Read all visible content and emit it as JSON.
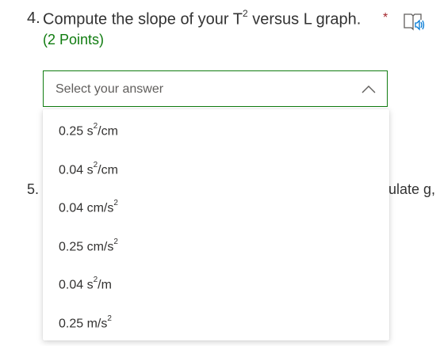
{
  "question4": {
    "number": "4.",
    "title_prefix": "Compute the slope of your T",
    "title_sup": "2",
    "title_suffix": " versus L graph.",
    "required_mark": "*",
    "points": "(2 Points)",
    "dropdown_placeholder": "Select your answer"
  },
  "question5": {
    "number": "5.",
    "visible_tail": "ulate g,"
  },
  "options": [
    {
      "pre": "0.25 s",
      "sup": "2",
      "post": "/cm"
    },
    {
      "pre": "0.04 s",
      "sup": "2",
      "post": "/cm"
    },
    {
      "pre": "0.04 cm/s",
      "sup": "2",
      "post": ""
    },
    {
      "pre": "0.25 cm/s",
      "sup": "2",
      "post": ""
    },
    {
      "pre": "0.04 s",
      "sup": "2",
      "post": "/m"
    },
    {
      "pre": "0.25 m/s",
      "sup": "2",
      "post": ""
    }
  ],
  "icons": {
    "reader": "immersive-reader-icon",
    "chevron": "chevron-up-icon"
  },
  "colors": {
    "accent_green": "#107c10",
    "required_red": "#a4262c",
    "icon_blue": "#0078d4"
  }
}
